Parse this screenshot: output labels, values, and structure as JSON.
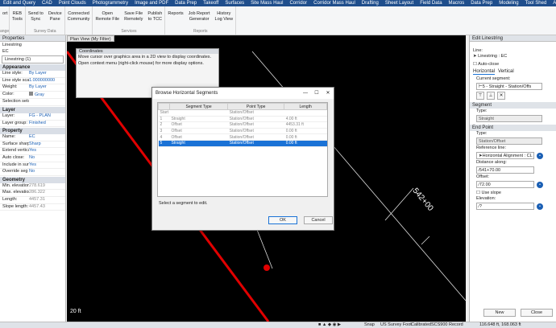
{
  "menu": [
    "Edit and Query",
    "CAD",
    "Point Clouds",
    "Photogrammetry",
    "Image and PDF",
    "Data Prep",
    "Takeoff",
    "Surfaces",
    "Site Mass Haul",
    "Corridor",
    "Corridor Mass Haul",
    "Drafting",
    "Sheet Layout",
    "Field Data",
    "Macros",
    "Data Prep",
    "Modeling",
    "Tool Shed",
    "ANZ",
    "Support"
  ],
  "ribbon": {
    "frag1": "ort",
    "frag2": "ange",
    "g1": {
      "b1": "REB",
      "b1b": "Tools"
    },
    "g2": {
      "b1": "Send to",
      "b1b": "Sync",
      "b2": "Device",
      "b2b": "Pane",
      "label": "Survey Data"
    },
    "g3": {
      "b1": "Connected",
      "b1b": "Community"
    },
    "g4": {
      "b1": "Open",
      "b1b": "Remote File",
      "b2": "Save File",
      "b2b": "Remotely",
      "b3": "Publish",
      "b3b": "to TCC",
      "label": "Services"
    },
    "g5": {
      "b1": "Reports",
      "b2": "Job Report",
      "b2b": "Generator",
      "b3": "History",
      "b3b": "Log View",
      "label": "Reports"
    }
  },
  "properties": {
    "title": "Properties",
    "top1": "Linestring",
    "top2": "EC",
    "count": "Linestring (1)",
    "sec_appearance": "Appearance",
    "sec_layer": "Layer",
    "sec_property": "Property",
    "sec_geometry": "Geometry",
    "rows": {
      "line_style": {
        "k": "Line style:",
        "v": "By Layer"
      },
      "line_scale": {
        "k": "Line style scal",
        "v": "1.000000000"
      },
      "weight": {
        "k": "Weight:",
        "v": "By Layer"
      },
      "color": {
        "k": "Color:",
        "v": "Gray"
      },
      "selset": {
        "k": "Selection sets:",
        "v": ""
      },
      "layer": {
        "k": "Layer:",
        "v": "FG - PLAN"
      },
      "layer_group": {
        "k": "Layer group:",
        "v": "Finished"
      },
      "name": {
        "k": "Name:",
        "v": "EC"
      },
      "surface_sharp": {
        "k": "Surface sharp:",
        "v": "Sharp"
      },
      "extend_vertical": {
        "k": "Extend vertical",
        "v": "Yes"
      },
      "auto_close": {
        "k": "Auto close:",
        "v": "No"
      },
      "include_surf": {
        "k": "Include in surf",
        "v": "Yes"
      },
      "override_seg": {
        "k": "Override seg",
        "v": "No"
      },
      "min_elev": {
        "k": "Min. elevation:",
        "v": "278.619"
      },
      "max_elev": {
        "k": "Max. elevation:",
        "v": "286.322"
      },
      "length": {
        "k": "Length:",
        "v": "4457.31"
      },
      "slope_length": {
        "k": "Slope length:",
        "v": "4457.43"
      }
    }
  },
  "view": {
    "tab": "Plan View (My Filter)",
    "scale": "20 ft",
    "station": "542+00",
    "coords": {
      "title": "Coordinates",
      "line1": "Move cursor over graphics area in a 2D view to display coordinates.",
      "line2": "Open context menu (right-click mouse) for more display options."
    }
  },
  "dialog": {
    "title": "Browse Horizontal Segments",
    "headers": [
      "Segment Type",
      "Point Type",
      "Length"
    ],
    "rows": [
      {
        "n": "Start",
        "seg": "",
        "pt": "Station/Offset",
        "len": ""
      },
      {
        "n": "1",
        "seg": "Straight",
        "pt": "Station/Offset",
        "len": "4.00 ft"
      },
      {
        "n": "2",
        "seg": "Offset",
        "pt": "Station/Offset",
        "len": "4453.31 ft"
      },
      {
        "n": "3",
        "seg": "Offset",
        "pt": "Station/Offset",
        "len": "0.00 ft"
      },
      {
        "n": "4",
        "seg": "Offset",
        "pt": "Station/Offset",
        "len": "0.00 ft"
      },
      {
        "n": "5",
        "seg": "Straight",
        "pt": "Station/Offset",
        "len": "0.00 ft"
      }
    ],
    "hint": "Select a segment to edit.",
    "ok": "OK",
    "cancel": "Cancel"
  },
  "edit": {
    "title": "Edit Linestring",
    "line_label": "Line:",
    "line_value": "Linestring : EC",
    "auto_close": "Auto-close",
    "tab_h": "Horizontal",
    "tab_v": "Vertical",
    "current_seg": "Current segment:",
    "current_seg_value": "5 - Straight - Station/Offs",
    "segment": "Segment",
    "type": "Type:",
    "type_value": "Straight",
    "endpoint": "End Point",
    "ep_type": "Type:",
    "ep_type_value": "Station/Offset",
    "ref_line": "Reference line:",
    "ref_value": "Horizontal Alignment : CL 7",
    "distance": "Distance along:",
    "distance_value": "541+70.00",
    "offset": "Offset:",
    "offset_value": "72.00",
    "use_slope": "Use slope",
    "elevation": "Elevation:",
    "elevation_value": "?",
    "new": "New",
    "close": "Close"
  },
  "status": {
    "snap": "Snap",
    "units": "US Survey Foot",
    "calibrated": "Calibrated",
    "scs": "SCS900 Record",
    "coords": "116.648 ft, 168.063 ft"
  },
  "colors": {
    "menubar": "#1f4e8c",
    "accent": "#1a72d6",
    "red_line": "#e00000"
  }
}
